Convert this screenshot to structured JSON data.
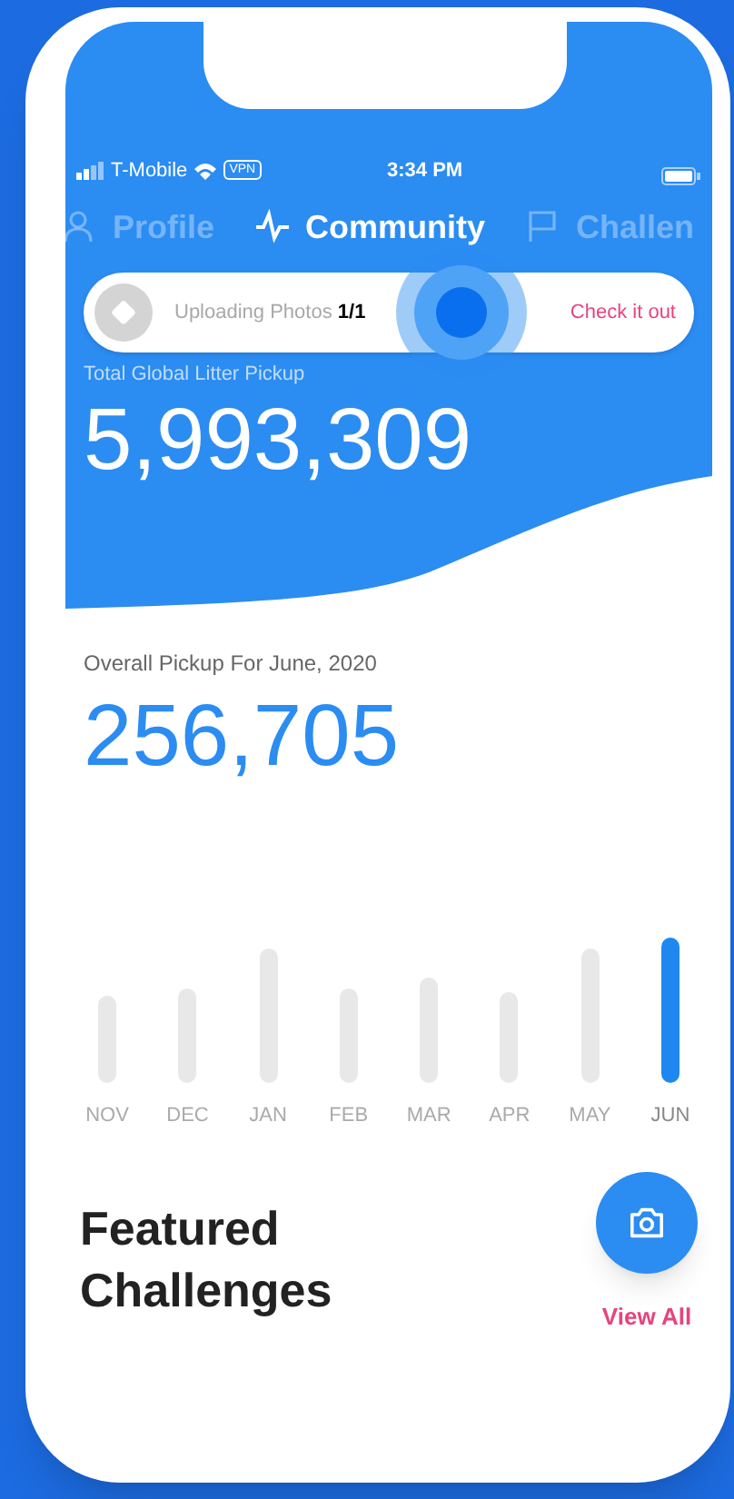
{
  "status_bar": {
    "carrier": "T-Mobile",
    "vpn": "VPN",
    "time": "3:34 PM"
  },
  "tabs": [
    {
      "label": "Profile",
      "kind": "person",
      "selected": false
    },
    {
      "label": "Community",
      "kind": "pulse",
      "selected": true
    },
    {
      "label": "Challen",
      "kind": "flag",
      "selected": false
    }
  ],
  "toast": {
    "text": "Uploading Photos",
    "count": "1/1",
    "action": "Check it out"
  },
  "total": {
    "label": "Total Global Litter Pickup",
    "value": "5,993,309"
  },
  "monthly": {
    "label": "Overall Pickup For June, 2020",
    "value": "256,705",
    "months": [
      {
        "label": "NOV",
        "selected": false
      },
      {
        "label": "DEC",
        "selected": false
      },
      {
        "label": "JAN",
        "selected": false
      },
      {
        "label": "FEB",
        "selected": false
      },
      {
        "label": "MAR",
        "selected": false
      },
      {
        "label": "APR",
        "selected": false
      },
      {
        "label": "MAY",
        "selected": false
      },
      {
        "label": "JUN",
        "selected": true
      }
    ]
  },
  "featured": {
    "title": "Featured Challenges",
    "link": "View All"
  }
}
